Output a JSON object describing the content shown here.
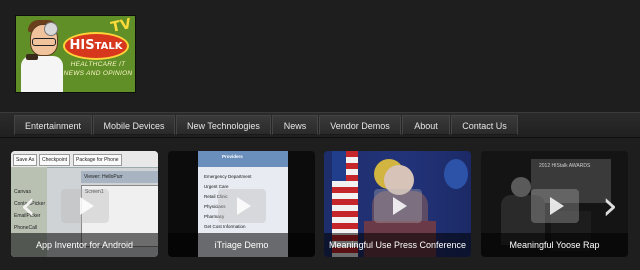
{
  "logo": {
    "his": "HIS",
    "talk": "TALK",
    "tv": "TV",
    "tagline_1": "HEALTHCARE IT",
    "tagline_2": "NEWS AND OPINION"
  },
  "nav": {
    "items": [
      {
        "label": "Entertainment"
      },
      {
        "label": "Mobile Devices"
      },
      {
        "label": "New Technologies"
      },
      {
        "label": "News"
      },
      {
        "label": "Vendor Demos"
      },
      {
        "label": "About"
      },
      {
        "label": "Contact Us"
      }
    ]
  },
  "videos": [
    {
      "title": "App Inventor for Android",
      "screen_labels": [
        "Save As",
        "Checkpoint",
        "Package for Phone",
        "Viewer: HelloPurr",
        "Screen1",
        "Canvas",
        "ContactPicker",
        "EmailPicker",
        "PhoneCall"
      ]
    },
    {
      "title": "iTriage Demo",
      "screen_labels": [
        "Providers",
        "Emergency Department",
        "Urgent Care",
        "Retail Clinic",
        "Physicians",
        "Pharmacy",
        "Get Cost Information"
      ]
    },
    {
      "title": "Meaningful Use Press Conference"
    },
    {
      "title": "Meaningful Yoose Rap",
      "screen_labels": [
        "2012 HIStalk AWARDS"
      ]
    }
  ],
  "colors": {
    "background": "#1e1e1e",
    "nav_text": "#e6e6e6",
    "caption_text": "#ffffff"
  }
}
